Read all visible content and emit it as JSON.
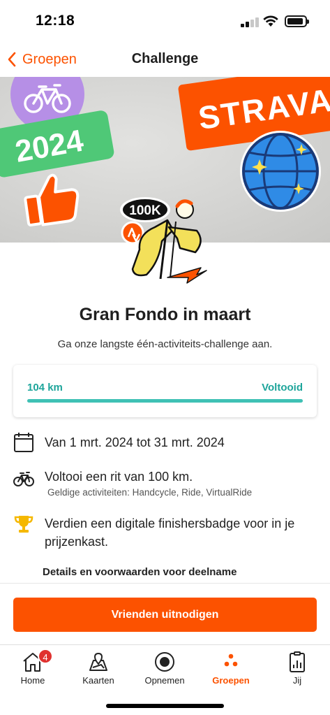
{
  "status_bar": {
    "time": "12:18"
  },
  "nav": {
    "back_label": "Groepen",
    "title": "Challenge"
  },
  "hero": {
    "brand_text": "STRAVA",
    "year_text": "2024"
  },
  "badge": {
    "distance_text": "100K"
  },
  "challenge": {
    "title": "Gran Fondo in maart",
    "subtitle": "Ga onze langste één-activiteits-challenge aan.",
    "progress_value": "104 km",
    "progress_status": "Voltooid",
    "progress_fraction": 1.0
  },
  "info": {
    "dates": "Van 1 mrt. 2024 tot 31 mrt. 2024",
    "goal": "Voltooi een rit van 100 km.",
    "valid_activities": "Geldige activiteiten: Handcycle, Ride, VirtualRide",
    "reward": "Verdien een digitale finishersbadge voor in je prijzenkast."
  },
  "details_link": "Details en voorwaarden voor deelname",
  "invite_button": "Vrienden uitnodigen",
  "tabs": [
    {
      "label": "Home",
      "icon": "home-icon",
      "badge": "4"
    },
    {
      "label": "Kaarten",
      "icon": "map-icon"
    },
    {
      "label": "Opnemen",
      "icon": "record-icon"
    },
    {
      "label": "Groepen",
      "icon": "groups-icon",
      "active": true
    },
    {
      "label": "Jij",
      "icon": "profile-stats-icon"
    }
  ],
  "colors": {
    "accent": "#fc5200",
    "progress": "#3fc1b5",
    "progress_text": "#1ea59b",
    "badge_red": "#e0322f"
  }
}
